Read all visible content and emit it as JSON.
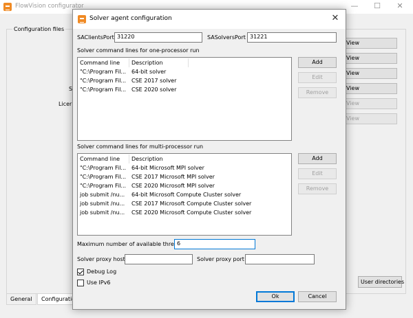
{
  "background_window": {
    "title": "FlowVision configurator",
    "controls": {
      "minimize": "—",
      "maximize": "☐",
      "close": "✕"
    },
    "group_title": "Configuration files",
    "view_buttons": [
      "View",
      "View",
      "View",
      "View",
      "View",
      "View"
    ],
    "partial_labels": [
      "S",
      "Licer"
    ],
    "user_directories_label": "User directories",
    "tabs": [
      "General",
      "Configuratio"
    ]
  },
  "dialog": {
    "title": "Solver agent configuration",
    "close_glyph": "✕",
    "saclients_label": "SAClientsPort",
    "saclients_value": "31220",
    "sasolvers_label": "SASolversPort",
    "sasolvers_value": "31221",
    "one_proc": {
      "section_label": "Solver command lines for one-processor run",
      "columns": [
        "Command line",
        "Description"
      ],
      "rows": [
        {
          "cmd": "\"C:\\Program Fil...",
          "desc": "64-bit solver"
        },
        {
          "cmd": "\"C:\\Program Fil...",
          "desc": "CSE 2017 solver"
        },
        {
          "cmd": "\"C:\\Program Fil...",
          "desc": "CSE 2020 solver"
        }
      ],
      "add": "Add",
      "edit": "Edit",
      "remove": "Remove"
    },
    "multi_proc": {
      "section_label": "Solver command lines for multi-processor run",
      "columns": [
        "Command line",
        "Description"
      ],
      "rows": [
        {
          "cmd": "\"C:\\Program Fil...",
          "desc": "64-bit Microsoft MPI solver"
        },
        {
          "cmd": "\"C:\\Program Fil...",
          "desc": "CSE 2017 Microsoft MPI solver"
        },
        {
          "cmd": "\"C:\\Program Fil...",
          "desc": "CSE 2020 Microsoft MPI solver"
        },
        {
          "cmd": "job submit /nu...",
          "desc": "64-bit Microsoft Compute Cluster solver"
        },
        {
          "cmd": "job submit /nu...",
          "desc": "CSE 2017 Microsoft Compute Cluster solver"
        },
        {
          "cmd": "job submit /nu...",
          "desc": "CSE 2020 Microsoft Compute Cluster solver"
        }
      ],
      "add": "Add",
      "edit": "Edit",
      "remove": "Remove"
    },
    "max_threads_label": "Maximum number of available threads",
    "max_threads_value": "6",
    "proxy_host_label": "Solver proxy host",
    "proxy_host_value": "",
    "proxy_port_label": "Solver proxy port",
    "proxy_port_value": "",
    "debug_log_label": "Debug Log",
    "debug_log_checked": true,
    "use_ipv6_label": "Use IPv6",
    "use_ipv6_checked": false,
    "ok_label": "Ok",
    "cancel_label": "Cancel"
  },
  "colors": {
    "accent": "#0078d7",
    "app_icon": "#f08a24"
  }
}
